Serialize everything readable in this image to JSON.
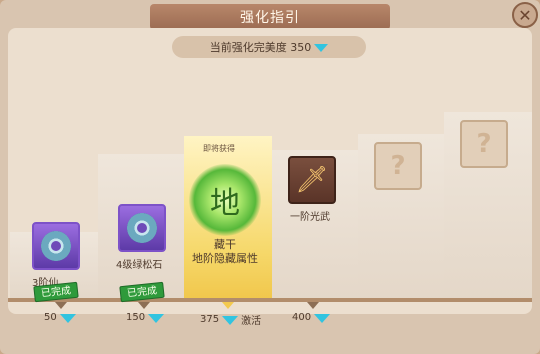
{
  "window": {
    "title": "强化指引"
  },
  "score": {
    "label": "当前强化完美度 350"
  },
  "columns": [
    {
      "item_label": "3阶仙...",
      "status": "已完成",
      "cost": "50",
      "icon": "jade-ring-icon"
    },
    {
      "item_label": "4级绿松石",
      "status": "已完成",
      "cost": "150",
      "icon": "jade-ring-icon"
    },
    {
      "top_note": "即将获得",
      "item_label1": "藏干",
      "item_label2": "地阶隐藏属性",
      "cost": "375",
      "action": "激活",
      "icon": "earth-glyph-icon",
      "glyph": "地"
    },
    {
      "item_label": "一阶光武",
      "cost": "400",
      "icon": "sword-icon"
    },
    {
      "icon": "locked-question-icon"
    },
    {
      "icon": "locked-question-icon"
    }
  ],
  "colors": {
    "gem": "#31c4e0",
    "done": "#2f9a3b",
    "highlight": "#f6d86a"
  }
}
